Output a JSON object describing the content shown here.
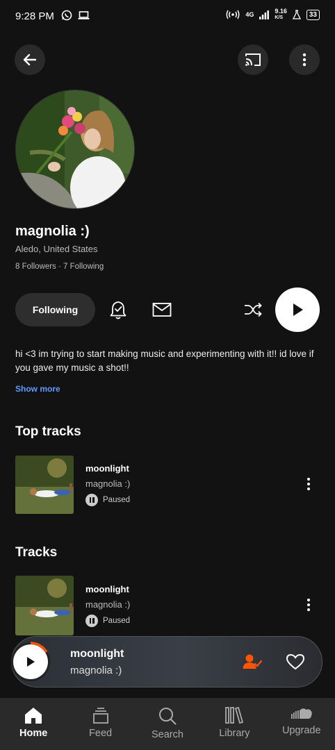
{
  "status_bar": {
    "time": "9:28 PM",
    "network": "4G",
    "speed_top": "9.16",
    "speed_unit": "K/S",
    "battery": "33"
  },
  "header": {
    "back_icon": "arrow-left-icon",
    "cast_icon": "cast-icon",
    "more_icon": "more-vertical-icon"
  },
  "profile": {
    "name": "magnolia :)",
    "location": "Aledo, United States",
    "followers": "8 Followers",
    "following_count": "7 Following",
    "follow_button": "Following",
    "bio": "hi <3 im trying to start making music and experimenting with it!! id love if you gave my music a shot!!",
    "show_more": "Show more"
  },
  "sections": {
    "top_tracks_title": "Top tracks",
    "tracks_title": "Tracks"
  },
  "top_tracks": [
    {
      "title": "moonlight",
      "artist": "magnolia :)",
      "status": "Paused"
    }
  ],
  "tracks": [
    {
      "title": "moonlight",
      "artist": "magnolia :)",
      "status": "Paused"
    }
  ],
  "mini_player": {
    "title": "moonlight",
    "artist": "magnolia :)",
    "accent": "#ff5500"
  },
  "nav": {
    "items": [
      {
        "label": "Home",
        "icon": "home-icon",
        "active": true
      },
      {
        "label": "Feed",
        "icon": "feed-icon",
        "active": false
      },
      {
        "label": "Search",
        "icon": "search-icon",
        "active": false
      },
      {
        "label": "Library",
        "icon": "library-icon",
        "active": false
      },
      {
        "label": "Upgrade",
        "icon": "soundcloud-icon",
        "active": false
      }
    ]
  }
}
